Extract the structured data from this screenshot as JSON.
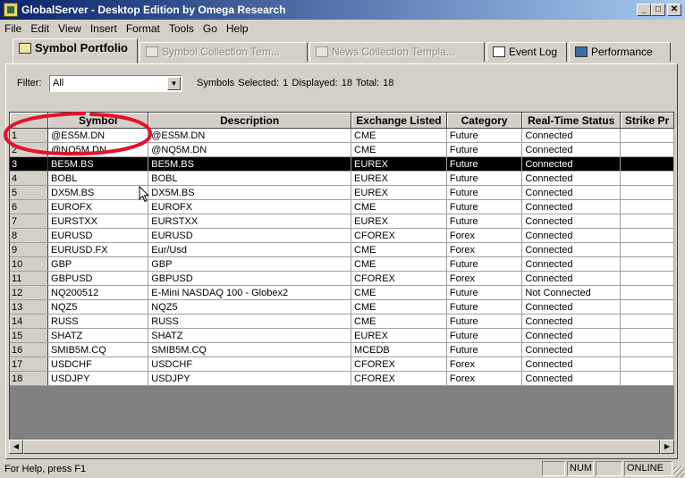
{
  "window": {
    "title": "GlobalServer - Desktop Edition by Omega Research",
    "controls": {
      "minimize": "_",
      "maximize": "□",
      "close": "✕"
    }
  },
  "menu": [
    {
      "label": "File"
    },
    {
      "label": "Edit"
    },
    {
      "label": "View"
    },
    {
      "label": "Insert"
    },
    {
      "label": "Format"
    },
    {
      "label": "Tools"
    },
    {
      "label": "Go"
    },
    {
      "label": "Help"
    }
  ],
  "tabs": [
    {
      "label": "Symbol Portfolio",
      "active": true,
      "enabled": true
    },
    {
      "label": "Symbol Collection Tem...",
      "active": false,
      "enabled": false
    },
    {
      "label": "News Collection Templa...",
      "active": false,
      "enabled": false
    },
    {
      "label": "Event Log",
      "active": false,
      "enabled": true
    },
    {
      "label": "Performance",
      "active": false,
      "enabled": true
    }
  ],
  "filter": {
    "label": "Filter:",
    "value": "All"
  },
  "stats": {
    "text": "Symbols  Selected: 1   Displayed: 18   Total: 18"
  },
  "grid": {
    "columns": [
      "",
      "Symbol",
      "Description",
      "Exchange Listed",
      "Category",
      "Real-Time Status",
      "Strike Pr"
    ],
    "rows": [
      {
        "num": "1",
        "symbol": "@ES5M.DN",
        "description": "@ES5M.DN",
        "exchange": "CME",
        "category": "Future",
        "status": "Connected"
      },
      {
        "num": "2",
        "symbol": "@NQ5M.DN",
        "description": "@NQ5M.DN",
        "exchange": "CME",
        "category": "Future",
        "status": "Connected"
      },
      {
        "num": "3",
        "symbol": "BE5M.BS",
        "description": "BE5M.BS",
        "exchange": "EUREX",
        "category": "Future",
        "status": "Connected",
        "selected": true
      },
      {
        "num": "4",
        "symbol": "BOBL",
        "description": "BOBL",
        "exchange": "EUREX",
        "category": "Future",
        "status": "Connected"
      },
      {
        "num": "5",
        "symbol": "DX5M.BS",
        "description": "DX5M.BS",
        "exchange": "EUREX",
        "category": "Future",
        "status": "Connected"
      },
      {
        "num": "6",
        "symbol": "EUROFX",
        "description": "EUROFX",
        "exchange": "CME",
        "category": "Future",
        "status": "Connected"
      },
      {
        "num": "7",
        "symbol": "EURSTXX",
        "description": "EURSTXX",
        "exchange": "EUREX",
        "category": "Future",
        "status": "Connected"
      },
      {
        "num": "8",
        "symbol": "EURUSD",
        "description": "EURUSD",
        "exchange": "CFOREX",
        "category": "Forex",
        "status": "Connected"
      },
      {
        "num": "9",
        "symbol": "EURUSD.FX",
        "description": "Eur/Usd",
        "exchange": "CME",
        "category": "Forex",
        "status": "Connected"
      },
      {
        "num": "10",
        "symbol": "GBP",
        "description": "GBP",
        "exchange": "CME",
        "category": "Future",
        "status": "Connected"
      },
      {
        "num": "11",
        "symbol": "GBPUSD",
        "description": "GBPUSD",
        "exchange": "CFOREX",
        "category": "Forex",
        "status": "Connected"
      },
      {
        "num": "12",
        "symbol": "NQ200512",
        "description": "E-Mini NASDAQ 100 - Globex2",
        "exchange": "CME",
        "category": "Future",
        "status": "Not Connected"
      },
      {
        "num": "13",
        "symbol": "NQZ5",
        "description": "NQZ5",
        "exchange": "CME",
        "category": "Future",
        "status": "Connected"
      },
      {
        "num": "14",
        "symbol": "RUSS",
        "description": "RUSS",
        "exchange": "CME",
        "category": "Future",
        "status": "Connected"
      },
      {
        "num": "15",
        "symbol": "SHATZ",
        "description": "SHATZ",
        "exchange": "EUREX",
        "category": "Future",
        "status": "Connected"
      },
      {
        "num": "16",
        "symbol": "SMIB5M.CQ",
        "description": "SMIB5M.CQ",
        "exchange": "MCEDB",
        "category": "Future",
        "status": "Connected"
      },
      {
        "num": "17",
        "symbol": "USDCHF",
        "description": "USDCHF",
        "exchange": "CFOREX",
        "category": "Forex",
        "status": "Connected"
      },
      {
        "num": "18",
        "symbol": "USDJPY",
        "description": "USDJPY",
        "exchange": "CFOREX",
        "category": "Forex",
        "status": "Connected"
      }
    ]
  },
  "statusbar": {
    "help": "For Help, press F1",
    "num": "NUM",
    "online": "ONLINE"
  },
  "colors": {
    "title_start": "#0a246a",
    "title_end": "#a6caf0",
    "face": "#d4d0c8",
    "selection": "#000000",
    "annotation": "#e8102a"
  },
  "icons": [
    "app-icon",
    "symbol-portfolio-icon",
    "event-log-icon",
    "performance-icon",
    "mouse-cursor-icon"
  ]
}
